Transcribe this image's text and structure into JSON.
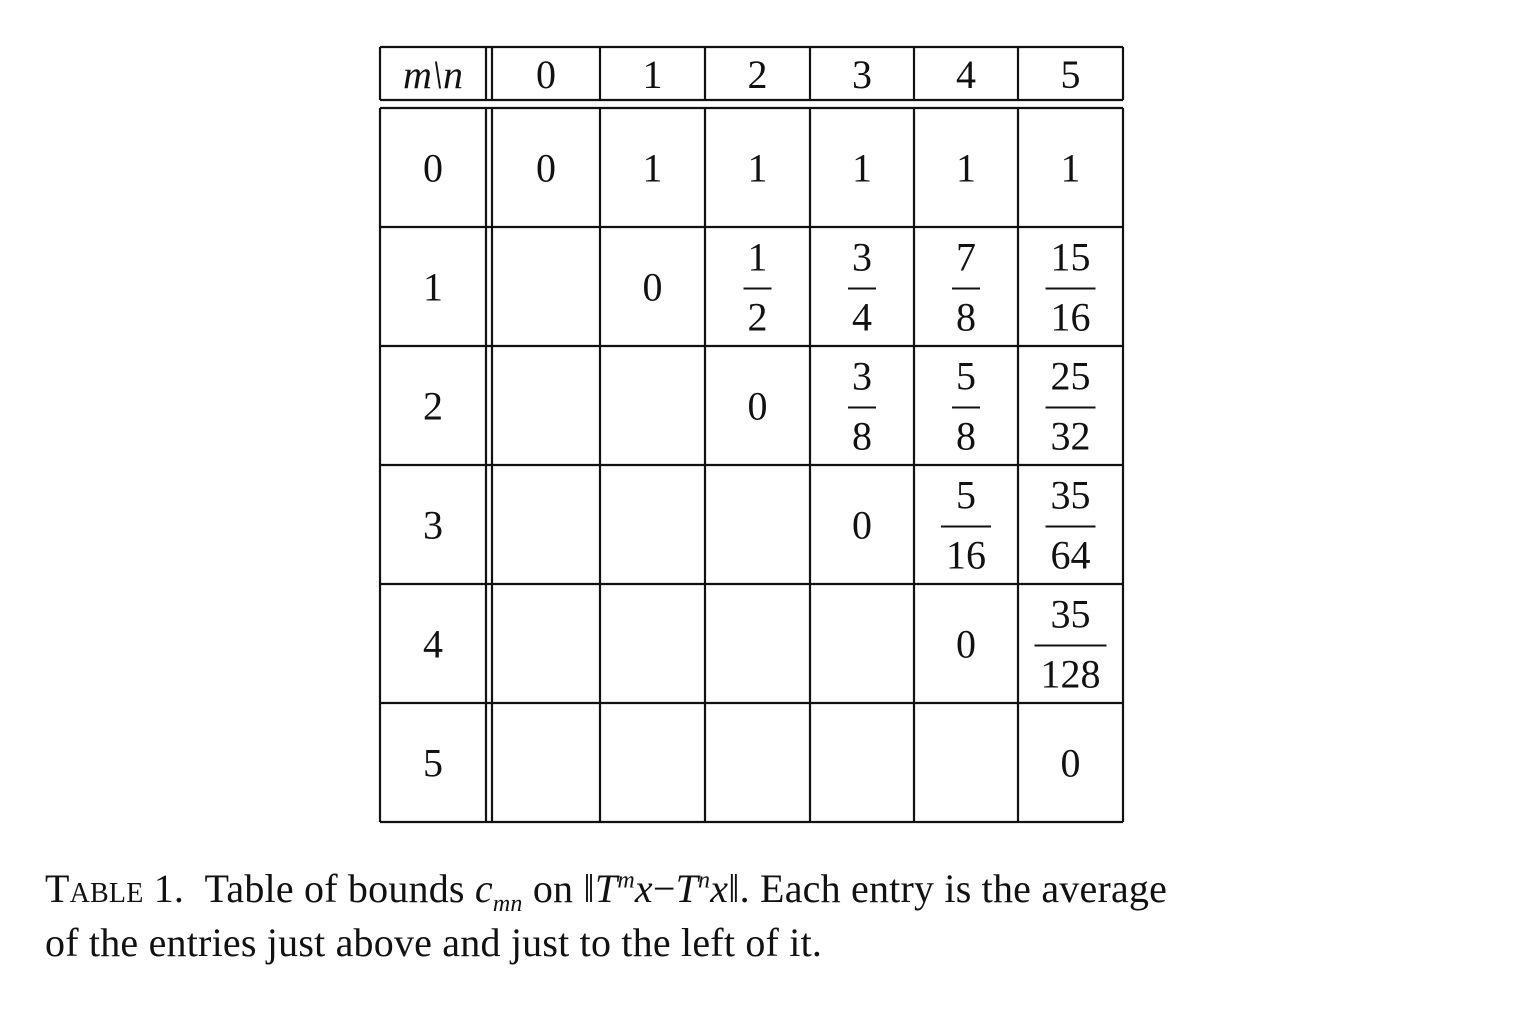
{
  "table": {
    "corner_label": "m\\n",
    "columns": [
      "0",
      "1",
      "2",
      "3",
      "4",
      "5"
    ],
    "rows": [
      {
        "label": "0",
        "cells": [
          {
            "v": "0"
          },
          {
            "v": "1"
          },
          {
            "v": "1"
          },
          {
            "v": "1"
          },
          {
            "v": "1"
          },
          {
            "v": "1"
          }
        ]
      },
      {
        "label": "1",
        "cells": [
          null,
          {
            "v": "0"
          },
          {
            "num": "1",
            "den": "2"
          },
          {
            "num": "3",
            "den": "4"
          },
          {
            "num": "7",
            "den": "8"
          },
          {
            "num": "15",
            "den": "16"
          }
        ]
      },
      {
        "label": "2",
        "cells": [
          null,
          null,
          {
            "v": "0"
          },
          {
            "num": "3",
            "den": "8"
          },
          {
            "num": "5",
            "den": "8"
          },
          {
            "num": "25",
            "den": "32"
          }
        ]
      },
      {
        "label": "3",
        "cells": [
          null,
          null,
          null,
          {
            "v": "0"
          },
          {
            "num": "5",
            "den": "16"
          },
          {
            "num": "35",
            "den": "64"
          }
        ]
      },
      {
        "label": "4",
        "cells": [
          null,
          null,
          null,
          null,
          {
            "v": "0"
          },
          {
            "num": "35",
            "den": "128"
          }
        ]
      },
      {
        "label": "5",
        "cells": [
          null,
          null,
          null,
          null,
          null,
          {
            "v": "0"
          }
        ]
      }
    ]
  },
  "caption": {
    "label": "Table 1.",
    "text_1": "Table of bounds",
    "symbol_c": "c",
    "symbol_c_sub": "mn",
    "text_2": "on",
    "norm_open": "‖",
    "T1": "T",
    "T1_sup": "m",
    "x1": "x",
    "minus": "−",
    "T2": "T",
    "T2_sup": "n",
    "x2": "x",
    "norm_close": "‖",
    "text_3": ". Each entry is the average",
    "line_2": "of the entries just above and just to the left of it."
  }
}
